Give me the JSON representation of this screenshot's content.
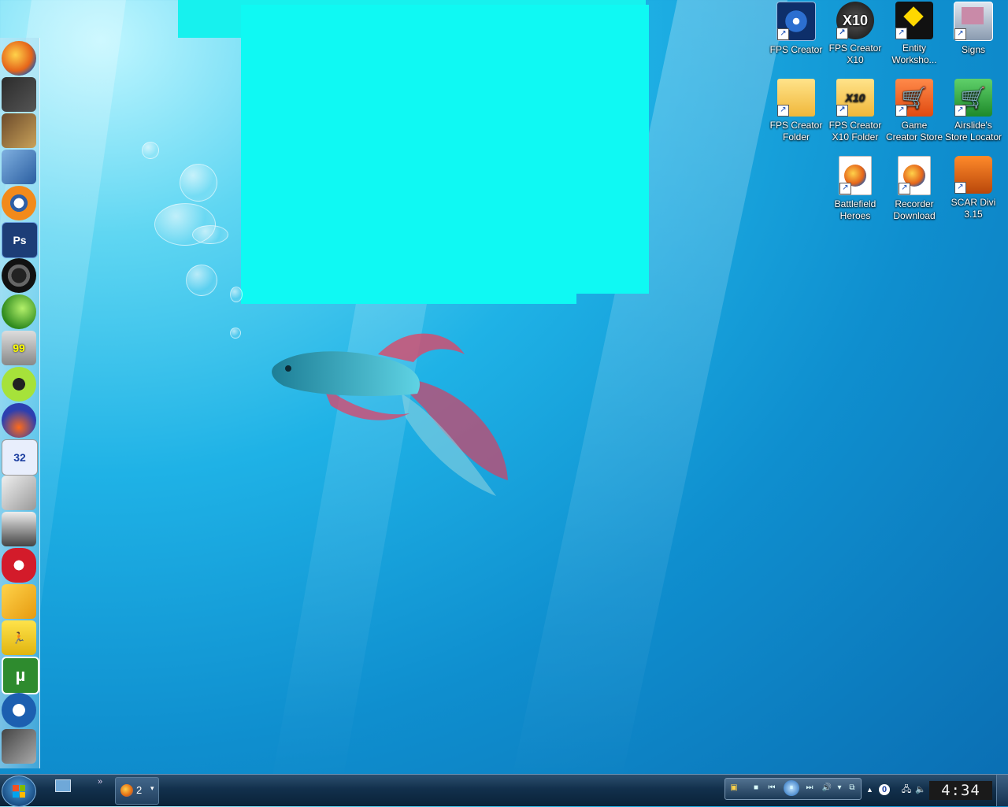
{
  "desktop": {
    "icons": [
      {
        "label": "FPS Creator",
        "icon": "fps-creator-icon"
      },
      {
        "label": "FPS Creator X10",
        "icon": "fps-creator-x10-icon"
      },
      {
        "label": "Entity Worksho...",
        "icon": "entity-workshop-icon"
      },
      {
        "label": "Signs",
        "icon": "signs-icon"
      },
      {
        "label": "FPS Creator Folder",
        "icon": "folder-icon"
      },
      {
        "label": "FPS Creator X10 Folder",
        "icon": "folder-x10-icon"
      },
      {
        "label": "Game Creator Store",
        "icon": "store-cart-icon"
      },
      {
        "label": "Airslide's Store Locator",
        "icon": "store-locator-icon"
      },
      {
        "label": "Battlefield Heroes",
        "icon": "firefox-document-icon"
      },
      {
        "label": "Recorder Download",
        "icon": "firefox-document-icon"
      },
      {
        "label": "SCAR Divi 3.15",
        "icon": "scar-bulldozer-icon"
      }
    ]
  },
  "dock": {
    "items": [
      {
        "name": "firefox-icon",
        "label": ""
      },
      {
        "name": "game-apps-icon",
        "label": ""
      },
      {
        "name": "map-monitor-icon",
        "label": ""
      },
      {
        "name": "design-tool-icon",
        "label": ""
      },
      {
        "name": "blender-icon",
        "label": ""
      },
      {
        "name": "photoshop-icon",
        "label": "Ps"
      },
      {
        "name": "webcam-icon",
        "label": ""
      },
      {
        "name": "green-orb-icon",
        "label": ""
      },
      {
        "name": "fraps-monitor-icon",
        "label": "99"
      },
      {
        "name": "xfire-icon",
        "label": ""
      },
      {
        "name": "audacity-icon",
        "label": ""
      },
      {
        "name": "calendar-32-icon",
        "label": "32"
      },
      {
        "name": "document-stack-icon",
        "label": ""
      },
      {
        "name": "phone-music-icon",
        "label": ""
      },
      {
        "name": "lips-icon",
        "label": ""
      },
      {
        "name": "gamepad-icon",
        "label": ""
      },
      {
        "name": "aim-running-man-icon",
        "label": ""
      },
      {
        "name": "utorrent-icon",
        "label": "µ"
      },
      {
        "name": "media-player-icon",
        "label": ""
      },
      {
        "name": "dock-logo-icon",
        "label": ""
      }
    ]
  },
  "taskbar": {
    "firefox_group_count": "2",
    "quicklaunch_more": "»",
    "clock": "4:34"
  },
  "colors": {
    "cyan_overlay": "#0ff9f3",
    "taskbar": "#12304c"
  }
}
